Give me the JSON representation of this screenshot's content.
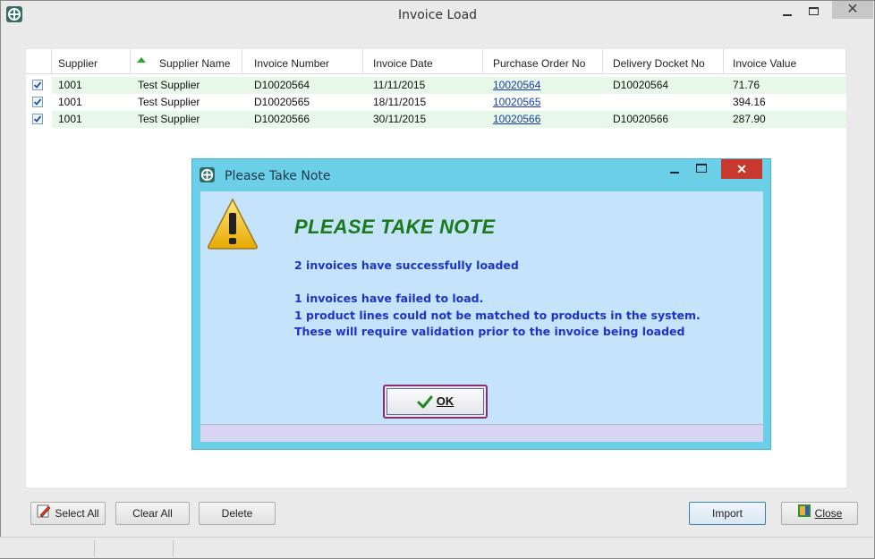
{
  "window": {
    "title": "Invoice Load"
  },
  "grid": {
    "columns": [
      "Supplier",
      "Supplier Name",
      "Invoice Number",
      "Invoice Date",
      "Purchase Order No",
      "Delivery Docket No",
      "Invoice Value"
    ],
    "rows": [
      {
        "checked": true,
        "supplier": "1001",
        "supplier_name": "Test Supplier",
        "invoice_number": "D10020564",
        "invoice_date": "11/11/2015",
        "po_no": "10020564",
        "docket_no": "D10020564",
        "value": "71.76"
      },
      {
        "checked": true,
        "supplier": "1001",
        "supplier_name": "Test Supplier",
        "invoice_number": "D10020565",
        "invoice_date": "18/11/2015",
        "po_no": "10020565",
        "docket_no": "",
        "value": "394.16"
      },
      {
        "checked": true,
        "supplier": "1001",
        "supplier_name": "Test Supplier",
        "invoice_number": "D10020566",
        "invoice_date": "30/11/2015",
        "po_no": "10020566",
        "docket_no": "D10020566",
        "value": "287.90"
      }
    ]
  },
  "buttons": {
    "select_all": "Select All",
    "clear_all": "Clear All",
    "delete": "Delete",
    "import": "Import",
    "close": "Close"
  },
  "dialog": {
    "title": "Please Take Note",
    "heading": "PLEASE TAKE NOTE",
    "line1": "2 invoices have successfully loaded",
    "line2": "1 invoices have failed to load.",
    "line3": "1 product lines could not be matched to products in the system.",
    "line4": "These will require validation prior to the invoice being loaded",
    "ok_label": "OK"
  },
  "colors": {
    "heading": "#1a7a1a",
    "message": "#1e34c8",
    "row_highlight": "#e8f8e8",
    "dialog_frame": "#6ccfe8"
  }
}
